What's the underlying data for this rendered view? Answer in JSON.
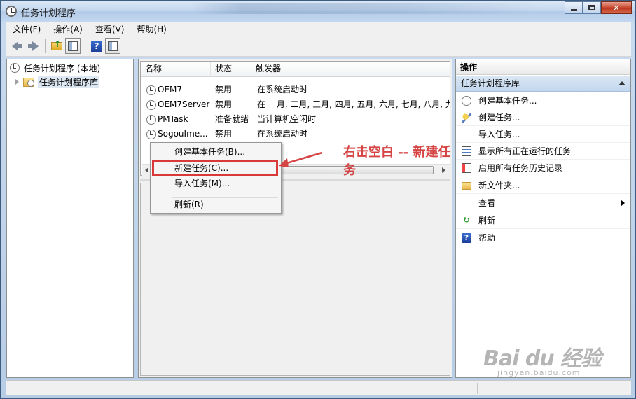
{
  "window": {
    "title": "任务计划程序"
  },
  "menubar": {
    "items": [
      "文件(F)",
      "操作(A)",
      "查看(V)",
      "帮助(H)"
    ]
  },
  "tree": {
    "root": "任务计划程序 (本地)",
    "child": "任务计划程序库"
  },
  "tasklist": {
    "columns": [
      "名称",
      "状态",
      "触发器"
    ],
    "rows": [
      {
        "name": "OEM7",
        "status": "禁用",
        "trigger": "在系统启动时"
      },
      {
        "name": "OEM7Server",
        "status": "禁用",
        "trigger": "在 一月, 二月, 三月, 四月, 五月, 六月, 七月, 八月, 九"
      },
      {
        "name": "PMTask",
        "status": "准备就绪",
        "trigger": "当计算机空闲时"
      },
      {
        "name": "SogouIme...",
        "status": "禁用",
        "trigger": "在系统启动时"
      }
    ]
  },
  "context_menu": {
    "items": [
      "创建基本任务(B)...",
      "新建任务(C)...",
      "导入任务(M)...",
      "刷新(R)"
    ],
    "highlighted": "新建任务(C)..."
  },
  "annotation": {
    "text": "右击空白 -- 新建任务",
    "color": "#d64545"
  },
  "actions_pane": {
    "header": "操作",
    "section": "任务计划程序库",
    "items": [
      {
        "label": "创建基本任务...",
        "icon": "clock-icon"
      },
      {
        "label": "创建任务...",
        "icon": "wand-icon"
      },
      {
        "label": "导入任务...",
        "icon": "none"
      },
      {
        "label": "显示所有正在运行的任务",
        "icon": "list-icon"
      },
      {
        "label": "启用所有任务历史记录",
        "icon": "history-icon"
      },
      {
        "label": "新文件夹...",
        "icon": "folder-icon"
      },
      {
        "label": "查看",
        "icon": "none"
      },
      {
        "label": "刷新",
        "icon": "refresh-icon"
      },
      {
        "label": "帮助",
        "icon": "help-icon"
      }
    ]
  },
  "watermark": {
    "logo": "Bai du 经验",
    "sub": "jingyan.baidu.com"
  }
}
